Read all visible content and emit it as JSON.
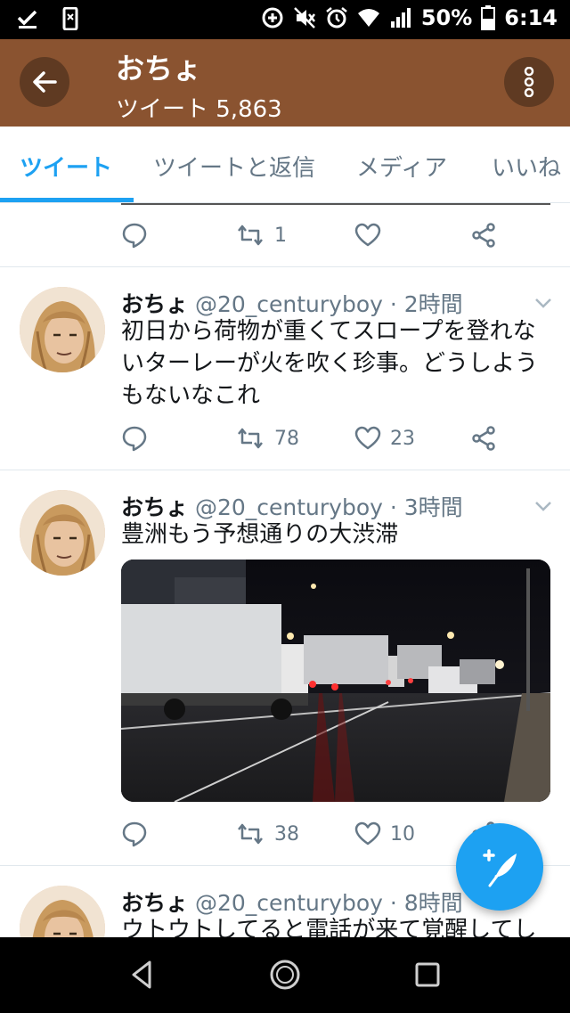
{
  "status_bar": {
    "battery": "50%",
    "time": "6:14"
  },
  "app_bar": {
    "title": "おちょ",
    "subtitle": "ツイート 5,863"
  },
  "tabs": [
    {
      "label": "ツイート",
      "active": true
    },
    {
      "label": "ツイートと返信",
      "active": false
    },
    {
      "label": "メディア",
      "active": false
    },
    {
      "label": "いいね",
      "active": false
    }
  ],
  "top_partial_actions": {
    "retweets": "1"
  },
  "tweets": [
    {
      "name": "おちょ",
      "meta": "@20_centuryboy · 2時間",
      "text": "初日から荷物が重くてスロープを登れないターレーが火を吹く珍事。どうしようもないなこれ",
      "retweets": "78",
      "likes": "23"
    },
    {
      "name": "おちょ",
      "meta": "@20_centuryboy · 3時間",
      "text": "豊洲もう予想通りの大渋滞",
      "retweets": "38",
      "likes": "10"
    },
    {
      "name": "おちょ",
      "meta": "@20_centuryboy · 8時間",
      "text": "ウトウトしてると電話が来て覚醒してし"
    }
  ],
  "colors": {
    "accent": "#1da1f2",
    "app_bar": "#8a5330",
    "secondary_text": "#657786"
  }
}
